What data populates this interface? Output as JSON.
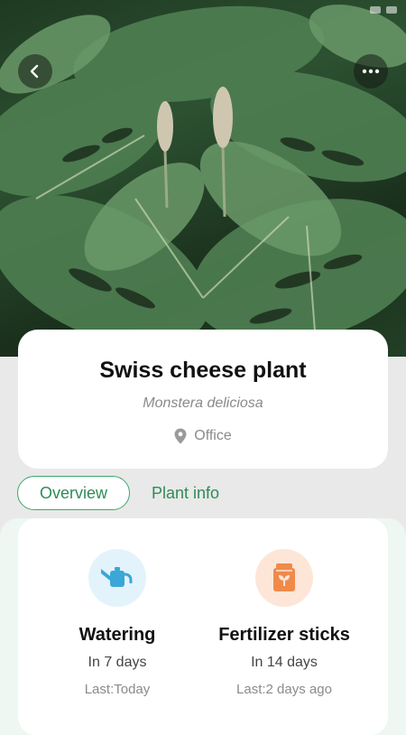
{
  "plant": {
    "name": "Swiss cheese plant",
    "latin_name": "Monstera deliciosa",
    "location": "Office"
  },
  "tabs": [
    {
      "label": "Overview",
      "active": true
    },
    {
      "label": "Plant info",
      "active": false
    }
  ],
  "care": [
    {
      "title": "Watering",
      "due": "In 7 days",
      "last": "Last:Today",
      "icon": "watering-can-icon",
      "icon_bg": "#e3f3fb",
      "icon_color": "#3aa7d8"
    },
    {
      "title": "Fertilizer sticks",
      "due": "In 14 days",
      "last": "Last:2 days ago",
      "icon": "fertilizer-bag-icon",
      "icon_bg": "#fde6d8",
      "icon_color": "#f08a4b"
    }
  ],
  "colors": {
    "accent": "#3aa96a",
    "tab_text": "#2e8b57"
  }
}
